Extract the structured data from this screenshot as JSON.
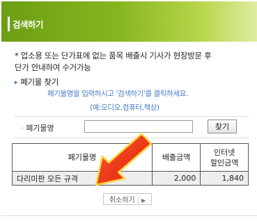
{
  "header": {
    "title": "검색하기"
  },
  "notice": {
    "line1": "* 업소용 또는 단가표에 없는 품목 배출시 기사가 현장방문 후",
    "line2": "단가 안내하여 수거가능"
  },
  "section": {
    "title": "폐기물 찾기"
  },
  "help": {
    "line1": "폐기물명을 입력하시고 '검색하기'를 클릭하세요.",
    "line2": "(예:오디오,컴퓨터,책상)"
  },
  "search": {
    "label": "폐기물명",
    "value": "",
    "placeholder": "",
    "button_label": "찾기"
  },
  "table": {
    "columns": [
      "폐기물명",
      "배출금액",
      "인터넷\n할인금액"
    ],
    "rows": [
      {
        "name": "다리미판 모든 규격",
        "fee": "2,000",
        "net_fee": "1,840"
      }
    ]
  },
  "cancel": {
    "label": "취소하기"
  },
  "colors": {
    "header_green": "#86b51e",
    "help_blue": "#4a7dc8",
    "arrow_red": "#e62b12"
  }
}
